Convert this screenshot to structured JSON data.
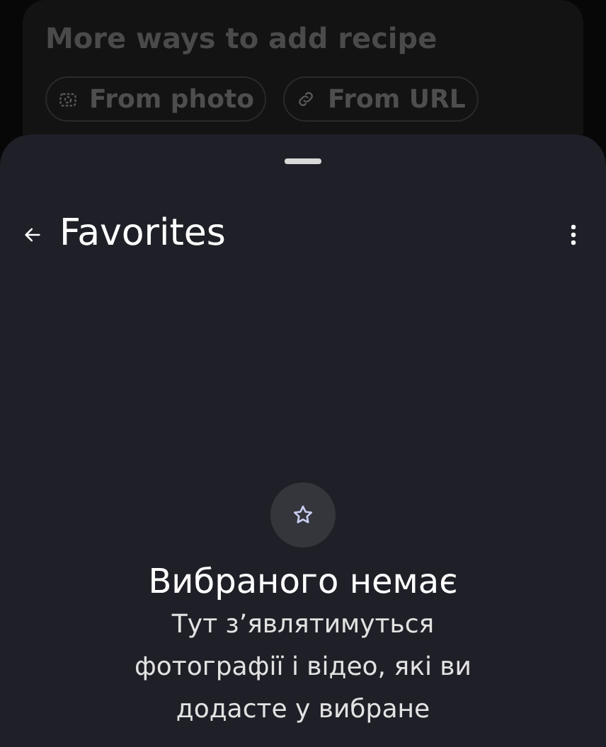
{
  "background_card": {
    "title": "More ways to add recipe",
    "chips": [
      {
        "kind": "photo",
        "label": "From photo"
      },
      {
        "kind": "url",
        "label": "From URL"
      }
    ]
  },
  "sheet": {
    "title": "Favorites",
    "empty_state": {
      "title": "Вибраного немає",
      "message": "Тут з’являтимуться фотографії і відео, які ви додасте у вибране"
    }
  }
}
